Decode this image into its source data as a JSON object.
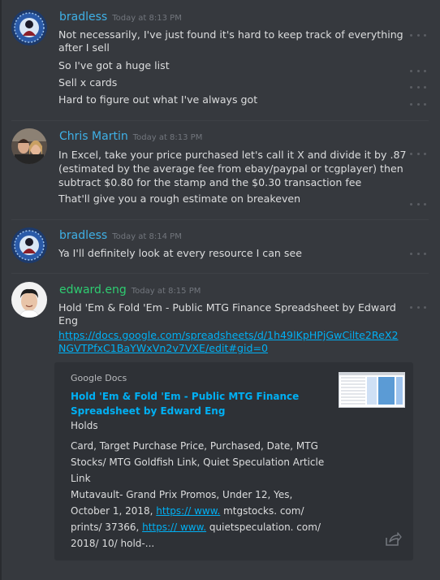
{
  "messages": [
    {
      "username": "bradless",
      "username_color": "#3fb0e6",
      "timestamp": "Today at 8:13 PM",
      "lines": [
        "Not necessarily, I've just found it's hard to keep track of everything after I sell",
        "So I've got a huge list",
        "Sell x cards",
        "Hard to figure out what I've always got"
      ]
    },
    {
      "username": "Chris Martin",
      "username_color": "#3fb0e6",
      "timestamp": "Today at 8:13 PM",
      "lines": [
        "In Excel, take your price purchased let's call it X and divide it by .87 (estimated by the average fee from ebay/paypal or tcgplayer) then subtract $0.80 for the stamp and the $0.30 transaction fee",
        "That'll give you a rough estimate on breakeven"
      ]
    },
    {
      "username": "bradless",
      "username_color": "#3fb0e6",
      "timestamp": "Today at 8:14 PM",
      "lines": [
        "Ya I'll definitely look at every resource I can see"
      ]
    },
    {
      "username": "edward.eng",
      "username_color": "#2ecc71",
      "timestamp": "Today at 8:15 PM",
      "lines": [
        "Hold 'Em & Fold 'Em - Public MTG Finance Spreadsheet by Edward Eng"
      ],
      "link": "https://docs.google.com/spreadsheets/d/1h49lKpHPjGwCilte2ReX2NGVTPfxC1BaYWxVn2v7VXE/edit#gid=0"
    }
  ],
  "embed": {
    "provider": "Google Docs",
    "title": "Hold 'Em & Fold 'Em - Public MTG Finance Spreadsheet by Edward Eng",
    "desc_heading": "Holds",
    "desc_line1": " Card, Target Purchase Price, Purchased, Date, MTG Stocks/ MTG Goldfish Link, Quiet Speculation Article Link",
    "desc_line2_prefix": " Mutavault- Grand Prix Promos, Under 12, Yes, October 1, 2018, ",
    "desc_link1": "https:// www.",
    "desc_line2_mid": " mtgstocks. com/ prints/ 37366, ",
    "desc_link2": "https:// www.",
    "desc_line2_suffix": " quietspeculation. com/ 2018/ 10/ hold-..."
  }
}
